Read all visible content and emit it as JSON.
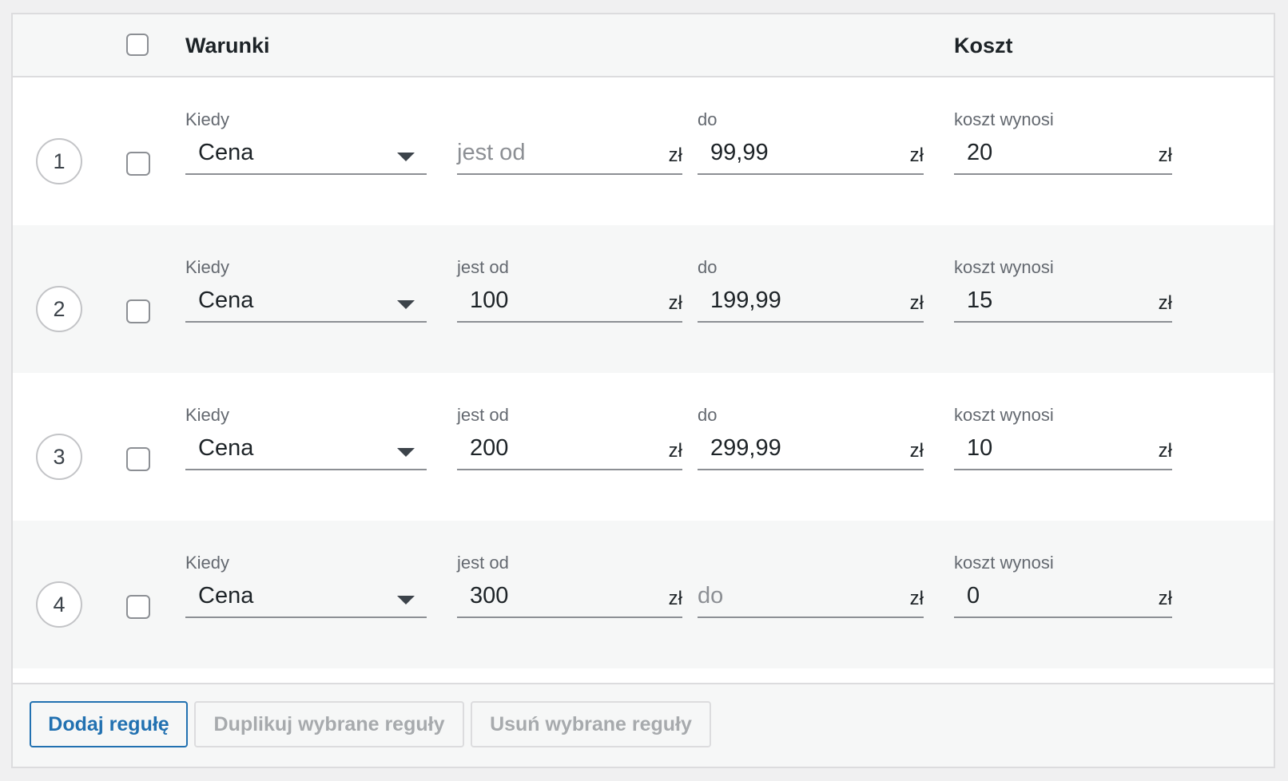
{
  "header": {
    "conditions_title": "Warunki",
    "cost_title": "Koszt"
  },
  "labels": {
    "kiedy": "Kiedy",
    "jest_od": "jest od",
    "do": "do",
    "koszt_wynosi": "koszt wynosi",
    "currency": "zł"
  },
  "rules": [
    {
      "num": "1",
      "checked": false,
      "condition": "Cena",
      "from_label": "",
      "from_value": "",
      "from_placeholder": "jest od",
      "to_label": "do",
      "to_value": "99,99",
      "to_placeholder": "",
      "cost_label": "koszt wynosi",
      "cost_value": "20"
    },
    {
      "num": "2",
      "checked": false,
      "condition": "Cena",
      "from_label": "jest od",
      "from_value": "100",
      "from_placeholder": "",
      "to_label": "do",
      "to_value": "199,99",
      "to_placeholder": "",
      "cost_label": "koszt wynosi",
      "cost_value": "15"
    },
    {
      "num": "3",
      "checked": false,
      "condition": "Cena",
      "from_label": "jest od",
      "from_value": "200",
      "from_placeholder": "",
      "to_label": "do",
      "to_value": "299,99",
      "to_placeholder": "",
      "cost_label": "koszt wynosi",
      "cost_value": "10"
    },
    {
      "num": "4",
      "checked": false,
      "condition": "Cena",
      "from_label": "jest od",
      "from_value": "300",
      "from_placeholder": "",
      "to_label": "",
      "to_value": "",
      "to_placeholder": "do",
      "cost_label": "koszt wynosi",
      "cost_value": "0"
    }
  ],
  "footer": {
    "add_label": "Dodaj regułę",
    "duplicate_label": "Duplikuj wybrane reguły",
    "delete_label": "Usuń wybrane reguły"
  },
  "colors": {
    "accent": "#2271b1",
    "row_alt_bg": "#f6f7f7",
    "disabled_text": "#a7aaad"
  }
}
